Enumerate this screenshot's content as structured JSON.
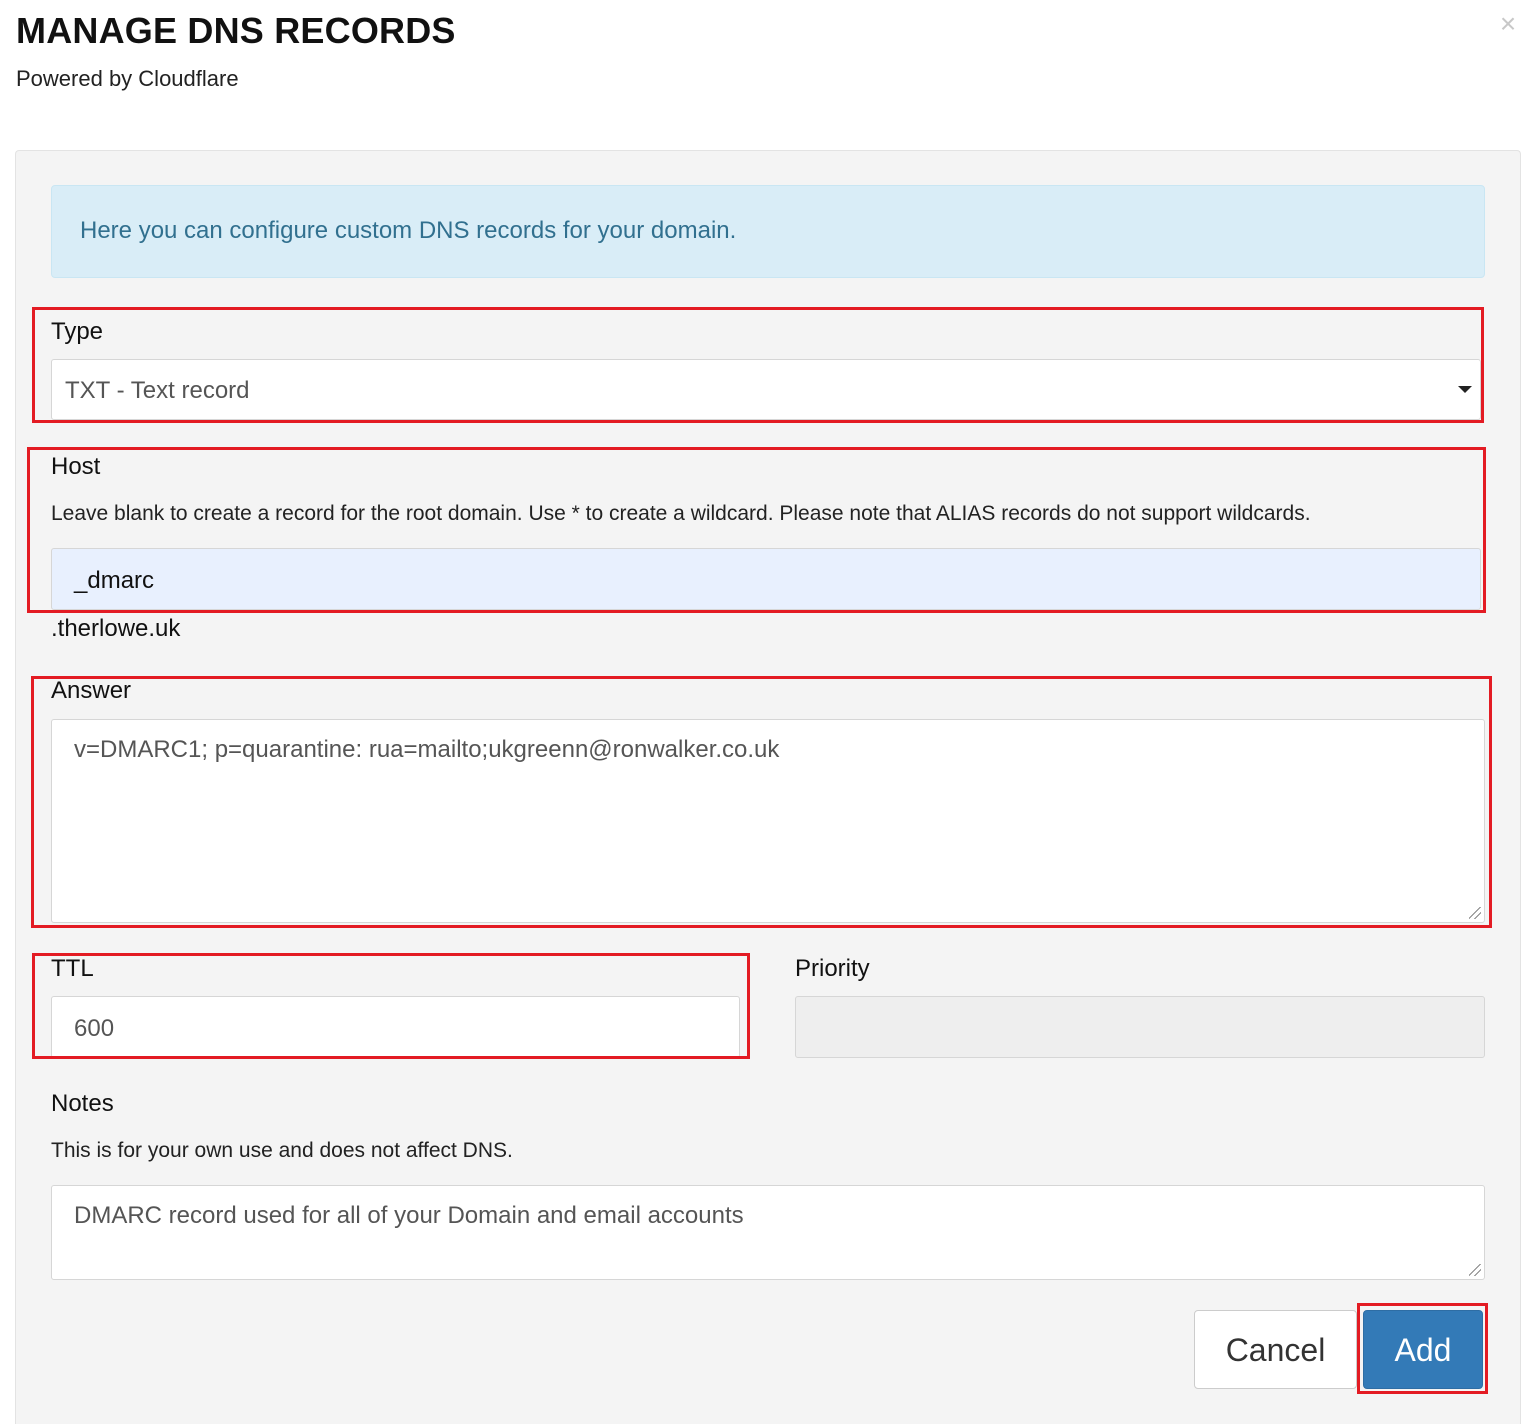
{
  "header": {
    "title": "MANAGE DNS RECORDS",
    "subtitle": "Powered by Cloudflare",
    "close_glyph": "×"
  },
  "info": {
    "text": "Here you can configure custom DNS records for your domain."
  },
  "form": {
    "type": {
      "label": "Type",
      "selected": "TXT - Text record"
    },
    "host": {
      "label": "Host",
      "help": "Leave blank to create a record for the root domain. Use * to create a wildcard. Please note that ALIAS records do not support wildcards.",
      "value": "_dmarc",
      "suffix": ".therlowe.uk"
    },
    "answer": {
      "label": "Answer",
      "value": "v=DMARC1; p=quarantine: rua=mailto;ukgreenn@ronwalker.co.uk"
    },
    "ttl": {
      "label": "TTL",
      "value": "600"
    },
    "priority": {
      "label": "Priority",
      "value": ""
    },
    "notes": {
      "label": "Notes",
      "help": "This is for your own use and does not affect DNS.",
      "value": "DMARC record used for all of your Domain and email accounts"
    }
  },
  "buttons": {
    "cancel_label": "Cancel",
    "add_label": "Add"
  },
  "colors": {
    "highlight": "#e31b23",
    "primary": "#337ab7",
    "info_bg": "#d9edf7",
    "info_text": "#31708f"
  }
}
